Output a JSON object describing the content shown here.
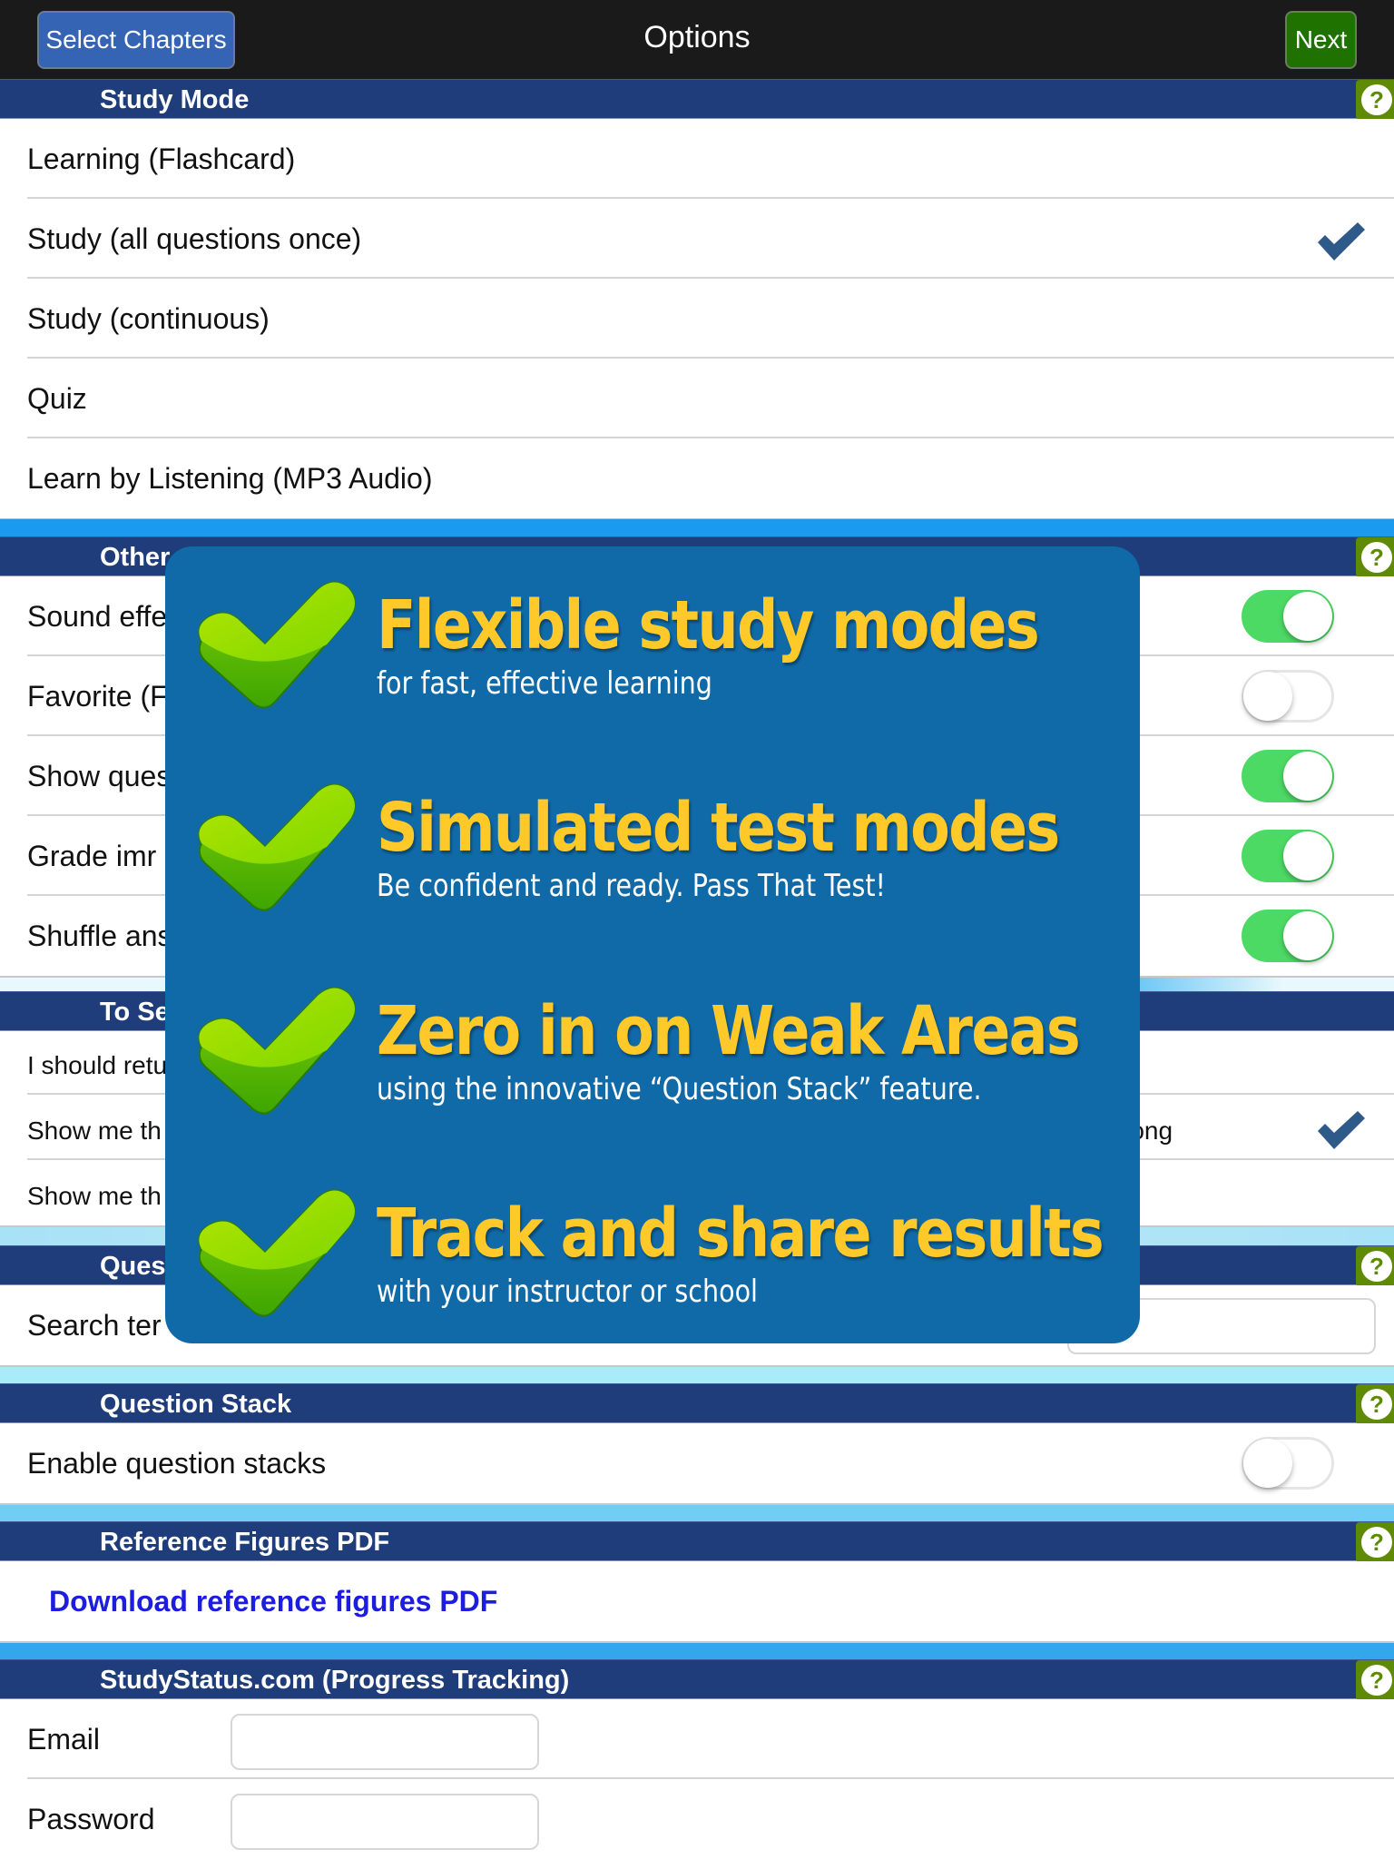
{
  "navbar": {
    "title": "Options",
    "left_button": "Select Chapters",
    "right_button": "Next"
  },
  "sections": {
    "study_mode": {
      "title": "Study Mode",
      "help": "?",
      "items": [
        {
          "label": "Learning (Flashcard)",
          "selected": false
        },
        {
          "label": "Study (all questions once)",
          "selected": true
        },
        {
          "label": "Study (continuous)",
          "selected": false
        },
        {
          "label": "Quiz",
          "selected": false
        },
        {
          "label": "Learn by Listening (MP3 Audio)",
          "selected": false
        }
      ]
    },
    "other": {
      "title_visible": "Other",
      "help": "?",
      "items": [
        {
          "label_visible": "Sound effe",
          "toggle": "on"
        },
        {
          "label_visible": "Favorite (F",
          "toggle": "off"
        },
        {
          "label_visible": "Show ques",
          "toggle": "on"
        },
        {
          "label_visible": "Grade imr",
          "toggle": "on"
        },
        {
          "label_visible": "Shuffle ans",
          "toggle": "on"
        }
      ]
    },
    "to_see": {
      "title_visible": "To Se",
      "items": [
        {
          "label_visible": "I should retu",
          "right_text": "",
          "selected": false
        },
        {
          "label_visible": "Show me th",
          "right_text": "vrong",
          "selected": true
        },
        {
          "label_visible": "Show me th",
          "right_text": "",
          "selected": false
        }
      ]
    },
    "questions": {
      "title_visible": "Ques",
      "help": "?",
      "search_label_visible": "Search ter",
      "search_value": ""
    },
    "question_stack": {
      "title": "Question Stack",
      "help": "?",
      "items": [
        {
          "label": "Enable question stacks",
          "toggle": "off"
        }
      ]
    },
    "reference": {
      "title": "Reference Figures PDF",
      "help": "?",
      "link": "Download reference figures PDF"
    },
    "studystatus": {
      "title": "StudyStatus.com (Progress Tracking)",
      "help": "?",
      "email_label": "Email",
      "email_value": "",
      "password_label": "Password",
      "password_value": ""
    }
  },
  "overlay": {
    "features": [
      {
        "title": "Flexible study modes",
        "subtitle": "for fast, effective learning"
      },
      {
        "title": "Simulated test modes",
        "subtitle": "Be confident and ready.  Pass That Test!"
      },
      {
        "title": "Zero in on Weak Areas",
        "subtitle": "using the innovative “Question Stack” feature."
      },
      {
        "title": "Track and share results",
        "subtitle": "with your instructor or school"
      }
    ]
  },
  "colors": {
    "navbar_bg": "#1a1a1a",
    "section_header_bg": "#1f3d7a",
    "help_badge_bg": "#5e8a06",
    "toggle_on": "#4cd964",
    "checkmark": "#2e5a8a",
    "overlay_bg": "#106aa8",
    "overlay_title": "#ffc929",
    "link": "#1d1de0",
    "select_chapters_bg": "#3564b4",
    "next_bg": "#1f7200"
  }
}
